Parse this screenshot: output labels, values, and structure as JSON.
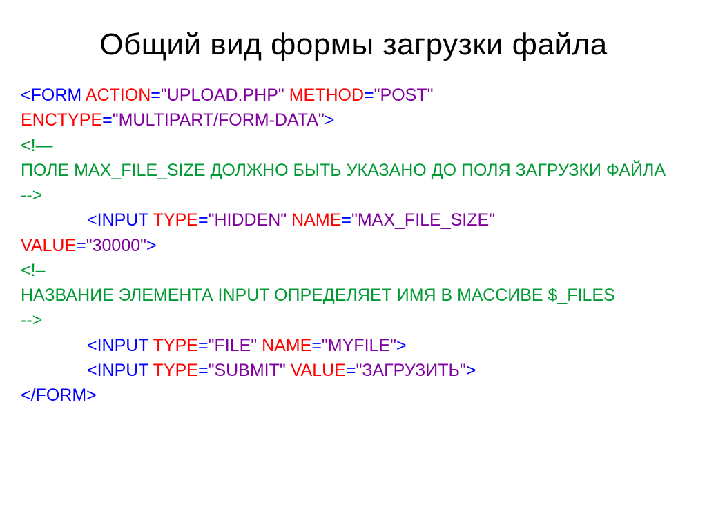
{
  "title": "Общий вид формы загрузки файла",
  "code": {
    "l1_open": "<",
    "l1_form": "FORM",
    "l1_sp1": " ",
    "l1_action": "ACTION",
    "l1_eq1": "=",
    "l1_actionv": "\"UPLOAD.PHP\"",
    "l1_sp2": " ",
    "l1_method": "METHOD",
    "l1_eq2": "=",
    "l1_methodv": "\"POST\"",
    "l2_enctype": "ENCTYPE",
    "l2_eq": "=",
    "l2_enctypev": "\"MULTIPART/FORM-DATA\"",
    "l2_close": ">",
    "l3": "<!—",
    "l4": "ПОЛЕ MAX_FILE_SIZE ДОЛЖНО БЫТЬ УКАЗАНО ДО ПОЛЯ ЗАГРУЗКИ ФАЙЛА",
    "l5": "-->",
    "l6_open": "<",
    "l6_input": "INPUT",
    "l6_sp1": " ",
    "l6_type": "TYPE",
    "l6_eq1": "=",
    "l6_typev": "\"HIDDEN\"",
    "l6_sp2": " ",
    "l6_name": "NAME",
    "l6_eq2": "=",
    "l6_namev": "\"MAX_FILE_SIZE\"",
    "l7_value": "VALUE",
    "l7_eq": "=",
    "l7_valuev": "\"30000\"",
    "l7_close": ">",
    "l8": "<!–",
    "l9": "НАЗВАНИЕ ЭЛЕМЕНТА INPUT ОПРЕДЕЛЯЕТ ИМЯ В МАССИВЕ $_FILES",
    "l10": "-->",
    "l11_open": "<",
    "l11_input": "INPUT",
    "l11_sp1": " ",
    "l11_type": "TYPE",
    "l11_eq1": "=",
    "l11_typev": "\"FILE\"",
    "l11_sp2": " ",
    "l11_name": "NAME",
    "l11_eq2": "=",
    "l11_namev": "\"MYFILE\"",
    "l11_close": ">",
    "l12_open": "<",
    "l12_input": "INPUT",
    "l12_sp1": " ",
    "l12_type": "TYPE",
    "l12_eq1": "=",
    "l12_typev": "\"SUBMIT\"",
    "l12_sp2": " ",
    "l12_value": "VALUE",
    "l12_eq2": "=",
    "l12_valuev": "\"ЗАГРУЗИТЬ\"",
    "l12_close": ">",
    "l13_open": "</",
    "l13_form": "FORM",
    "l13_close": ">"
  }
}
